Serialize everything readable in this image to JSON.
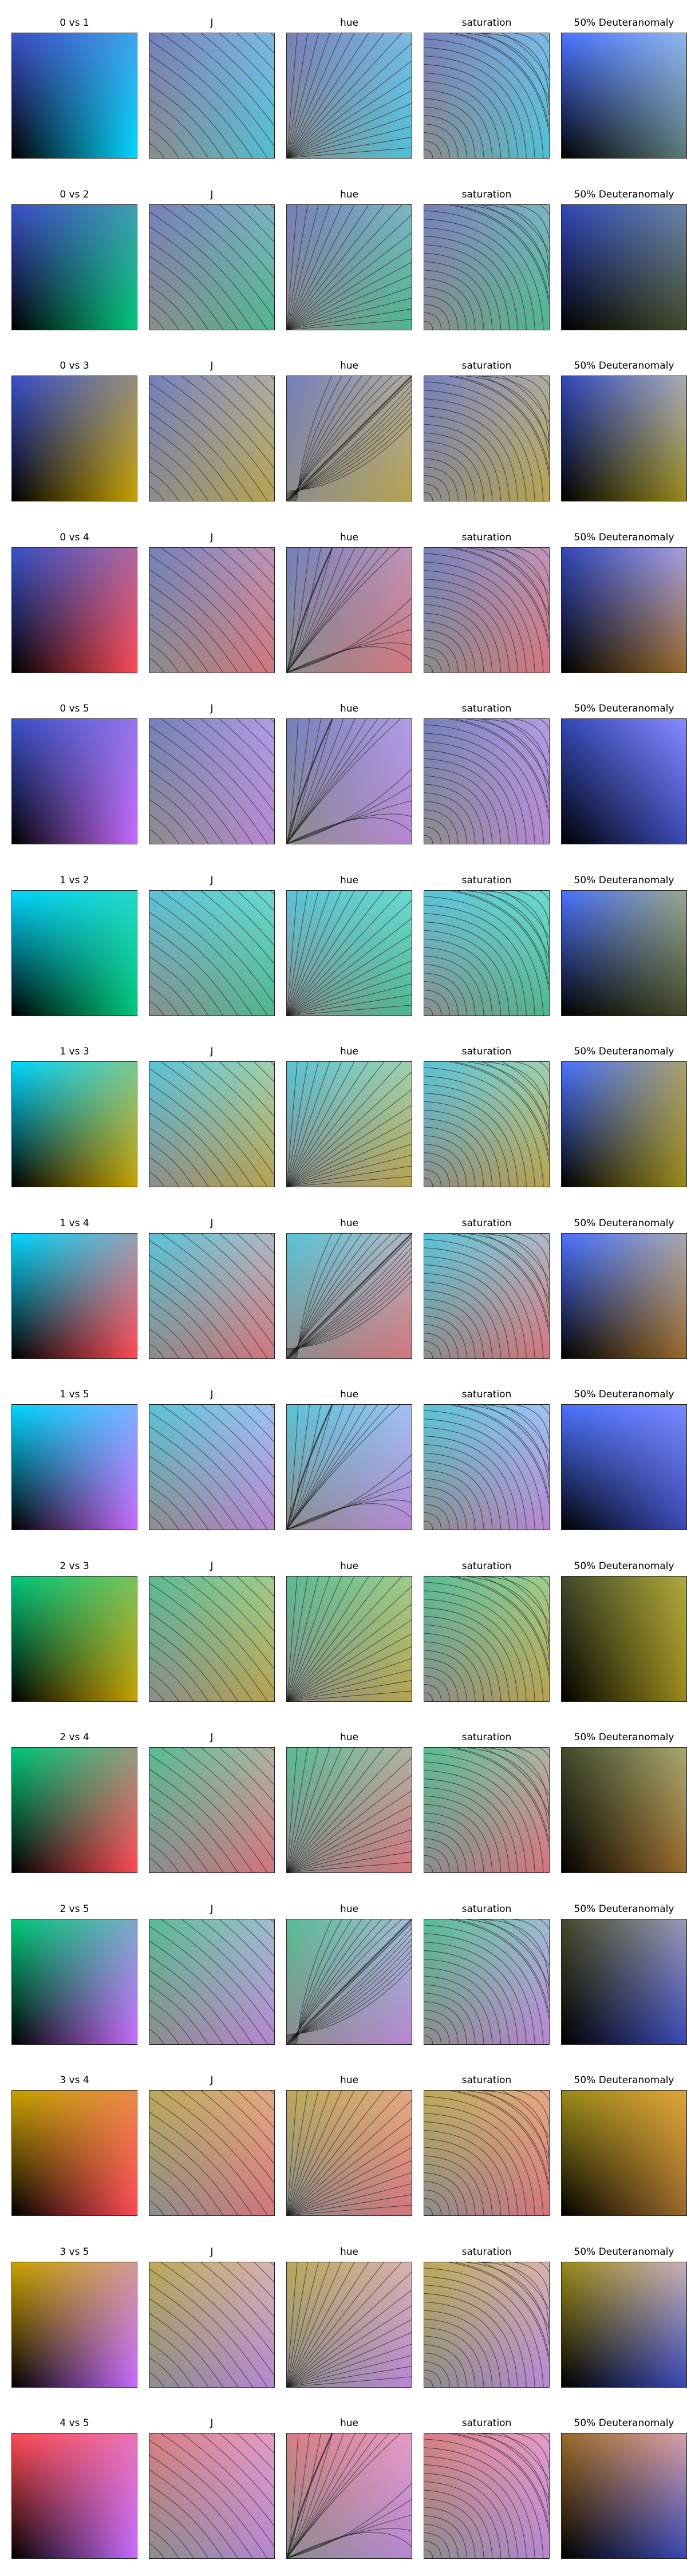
{
  "chart_data": {
    "type": "heatmap",
    "column_titles": [
      "",
      "J",
      "hue",
      "saturation",
      "50% Deuteranomaly"
    ],
    "colors": {
      "0": "#3a50c8",
      "1": "#00d8ff",
      "2": "#00c87a",
      "3": "#c8a200",
      "4": "#ff4a54",
      "5": "#c86bff"
    },
    "rows": [
      {
        "title": "0 vs 1",
        "a": "0",
        "b": "1",
        "d_top": "#4a72ff",
        "d_right": "#5a7a7a",
        "d_tr": "#8fb6ee",
        "hue": "fan"
      },
      {
        "title": "0 vs 2",
        "a": "0",
        "b": "2",
        "d_top": "#3048b8",
        "d_right": "#424a2a",
        "d_tr": "#6a84a8",
        "hue": "fan"
      },
      {
        "title": "0 vs 3",
        "a": "0",
        "b": "3",
        "d_top": "#3048b8",
        "d_right": "#9a8a1a",
        "d_tr": "#a8acb8",
        "hue": "diag"
      },
      {
        "title": "0 vs 4",
        "a": "0",
        "b": "4",
        "d_top": "#3048b8",
        "d_right": "#9a6a2a",
        "d_tr": "#a8a0e0",
        "hue": "bend"
      },
      {
        "title": "0 vs 5",
        "a": "0",
        "b": "5",
        "d_top": "#3048b8",
        "d_right": "#3a4ab8",
        "d_tr": "#8a8aff",
        "hue": "bend"
      },
      {
        "title": "1 vs 2",
        "a": "1",
        "b": "2",
        "d_top": "#4a72ff",
        "d_right": "#424a2a",
        "d_tr": "#9aa890",
        "hue": "fan"
      },
      {
        "title": "1 vs 3",
        "a": "1",
        "b": "3",
        "d_top": "#4a72ff",
        "d_right": "#9a8a1a",
        "d_tr": "#a8a070",
        "hue": "fan"
      },
      {
        "title": "1 vs 4",
        "a": "1",
        "b": "4",
        "d_top": "#4a72ff",
        "d_right": "#9a6a2a",
        "d_tr": "#a8a8b0",
        "hue": "diag"
      },
      {
        "title": "1 vs 5",
        "a": "1",
        "b": "5",
        "d_top": "#4a72ff",
        "d_right": "#3a4ab8",
        "d_tr": "#7a8aff",
        "hue": "bend"
      },
      {
        "title": "2 vs 3",
        "a": "2",
        "b": "3",
        "d_top": "#424a2a",
        "d_right": "#9a8a1a",
        "d_tr": "#b0a83a",
        "hue": "fan"
      },
      {
        "title": "2 vs 4",
        "a": "2",
        "b": "4",
        "d_top": "#424a2a",
        "d_right": "#9a6a2a",
        "d_tr": "#a8a870",
        "hue": "fan"
      },
      {
        "title": "2 vs 5",
        "a": "2",
        "b": "5",
        "d_top": "#424a2a",
        "d_right": "#3a4ab8",
        "d_tr": "#9a9ab8",
        "hue": "diag"
      },
      {
        "title": "3 vs 4",
        "a": "3",
        "b": "4",
        "d_top": "#9a8a1a",
        "d_right": "#9a6a2a",
        "d_tr": "#e0a43a",
        "hue": "fan"
      },
      {
        "title": "3 vs 5",
        "a": "3",
        "b": "5",
        "d_top": "#9a8a1a",
        "d_right": "#3a4ab8",
        "d_tr": "#c8b0b8",
        "hue": "fan"
      },
      {
        "title": "4 vs 5",
        "a": "4",
        "b": "5",
        "d_top": "#9a6a2a",
        "d_right": "#3a4ab8",
        "d_tr": "#d8a0a8",
        "hue": "bend"
      }
    ]
  }
}
